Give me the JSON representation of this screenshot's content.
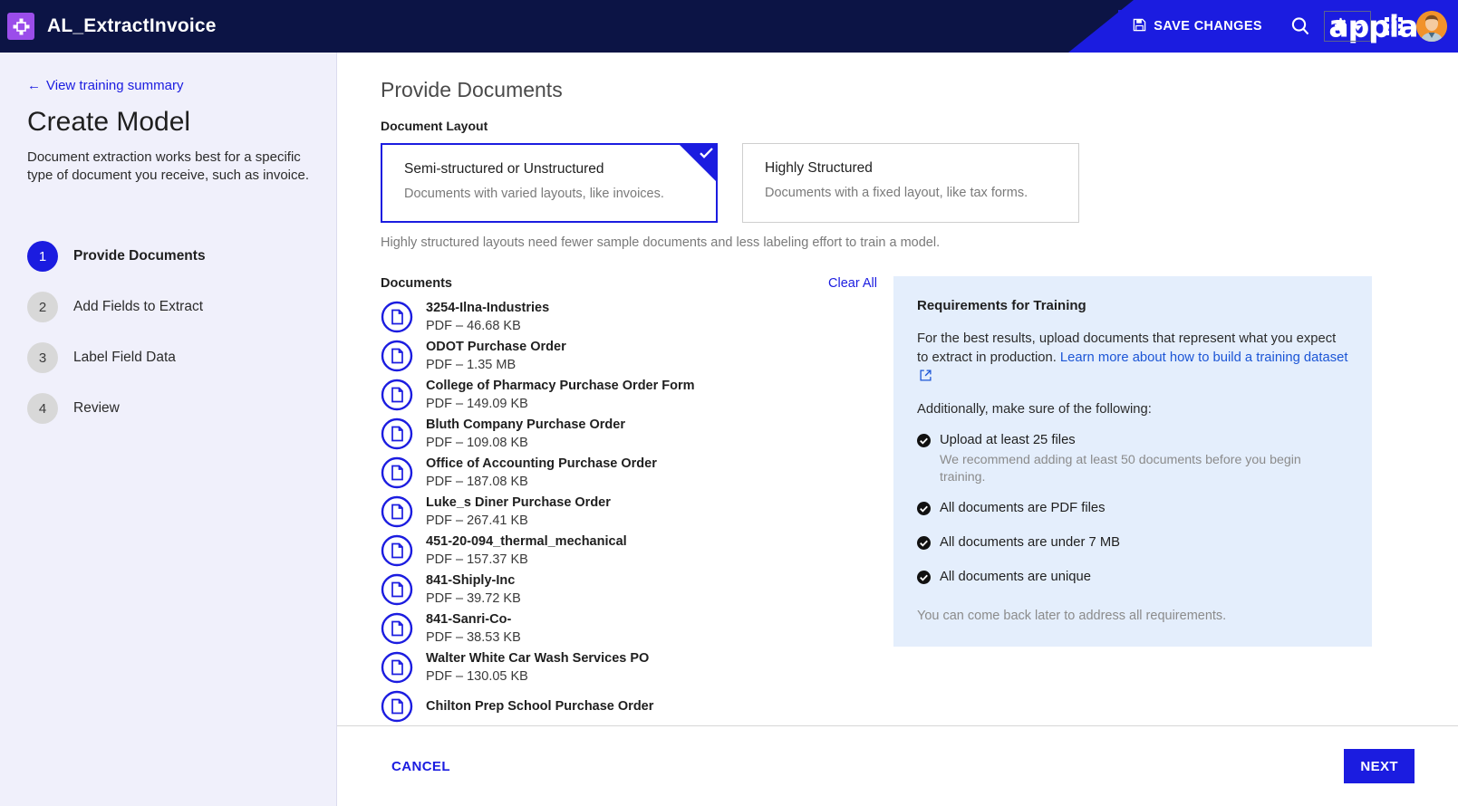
{
  "header": {
    "app_title": "AL_ExtractInvoice",
    "logo_icon": "appian-app-icon",
    "save_label": "SAVE CHANGES",
    "save_icon": "save-disk-icon",
    "search_icon": "search-icon",
    "settings_icon": "gear-icon",
    "settings_caret_icon": "chevron-down-icon",
    "apps_icon": "grid-apps-icon",
    "avatar_icon": "user-avatar",
    "brand": "appian",
    "colors": {
      "header_bg": "#0c1445",
      "accent": "#1b1ce0",
      "app_logo_bg": "#9b4dea",
      "avatar_bg": "#f1922b"
    }
  },
  "sidebar": {
    "back_link": "View training summary",
    "back_icon": "arrow-left-icon",
    "title": "Create Model",
    "description": "Document extraction works best for a specific type of document you receive, such as invoice.",
    "steps": [
      {
        "num": "1",
        "label": "Provide Documents",
        "active": true
      },
      {
        "num": "2",
        "label": "Add Fields to Extract",
        "active": false
      },
      {
        "num": "3",
        "label": "Label Field Data",
        "active": false
      },
      {
        "num": "4",
        "label": "Review",
        "active": false
      }
    ]
  },
  "main": {
    "section_title": "Provide Documents",
    "layout_label": "Document Layout",
    "layout_cards": [
      {
        "name": "Semi-structured or Unstructured",
        "sub": "Documents with varied layouts, like invoices.",
        "selected": true
      },
      {
        "name": "Highly Structured",
        "sub": "Documents with a fixed layout, like tax forms.",
        "selected": false
      }
    ],
    "layout_hint": "Highly structured layouts need fewer sample documents and less labeling effort to train a model.",
    "documents_label": "Documents",
    "clear_all_label": "Clear All",
    "documents": [
      {
        "name": "3254-Ilna-Industries",
        "meta": "PDF – 46.68 KB"
      },
      {
        "name": "ODOT Purchase Order",
        "meta": "PDF – 1.35 MB"
      },
      {
        "name": "College of Pharmacy Purchase Order Form",
        "meta": "PDF – 149.09 KB"
      },
      {
        "name": "Bluth Company Purchase Order",
        "meta": "PDF – 109.08 KB"
      },
      {
        "name": "Office of Accounting Purchase Order",
        "meta": "PDF – 187.08 KB"
      },
      {
        "name": "Luke_s Diner Purchase Order",
        "meta": "PDF – 267.41 KB"
      },
      {
        "name": "451-20-094_thermal_mechanical",
        "meta": "PDF – 157.37 KB"
      },
      {
        "name": "841-Shiply-Inc",
        "meta": "PDF – 39.72 KB"
      },
      {
        "name": "841-Sanri-Co-",
        "meta": "PDF – 38.53 KB"
      },
      {
        "name": "Walter White Car Wash Services PO",
        "meta": "PDF – 130.05 KB"
      },
      {
        "name": "Chilton Prep School Purchase Order",
        "meta": ""
      }
    ]
  },
  "requirements": {
    "title": "Requirements for Training",
    "intro_before_link": "For the best results, upload documents that represent what you expect to extract in production. ",
    "link_text": "Learn more about how to build a training dataset",
    "link_icon": "external-link-icon",
    "additionally": "Additionally, make sure of the following:",
    "items": [
      {
        "label": "Upload at least 25 files",
        "sub": "We recommend adding at least 50 documents before you begin training."
      },
      {
        "label": "All documents are PDF files",
        "sub": ""
      },
      {
        "label": "All documents are under 7 MB",
        "sub": ""
      },
      {
        "label": "All documents are unique",
        "sub": ""
      }
    ],
    "footnote": "You can come back later to address all requirements."
  },
  "footer": {
    "cancel_label": "CANCEL",
    "next_label": "NEXT"
  }
}
